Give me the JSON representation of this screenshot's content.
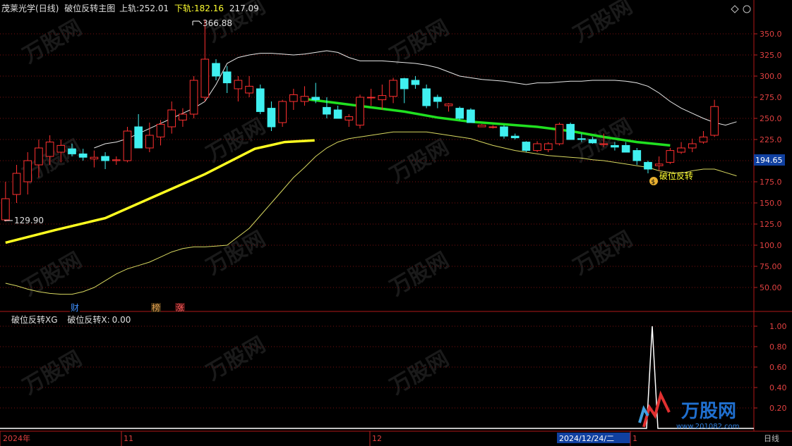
{
  "main_header": {
    "stock": "茂莱光学",
    "period": "(日线)",
    "indicator": "破位反转主图",
    "upper_label": "上轨:",
    "upper_value": "252.01",
    "lower_label": "下轨:",
    "lower_value": "182.16",
    "lower_value2": "217.09"
  },
  "sub_header": {
    "indicator": "破位反转XG",
    "item_label": "破位反转X:",
    "item_value": "0.00"
  },
  "annotations": {
    "high_label": "366.88",
    "low_label": "129.90",
    "signal_label": "破位反转",
    "current_price": "194.65",
    "tag_cai": "财",
    "tag_bang": "榜",
    "tag_zhang": "涨",
    "signal_coin": "$"
  },
  "x_axis": {
    "year": "2024年",
    "month_11": "11",
    "month_12": "12",
    "month_1": "1",
    "cursor_date": "2024/12/24/二",
    "period_label": "日线"
  },
  "watermark": {
    "brand": "万股网",
    "url": "www.201082.com"
  },
  "colors": {
    "up": "#ff3030",
    "down": "#40f0f0",
    "upper_band": "#e8e8e8",
    "lower_band": "#e8e850",
    "thick_yellow": "#ffff20",
    "thick_green": "#20e020",
    "axis": "#c02020"
  },
  "chart_data": [
    {
      "type": "candlestick",
      "title": "破位反转主图",
      "ylim": [
        30,
        375
      ],
      "y_ticks": [
        50,
        75,
        100,
        125,
        150,
        175,
        200,
        225,
        250,
        275,
        300,
        325,
        350
      ],
      "y_tick_labels": [
        "50.00",
        "75.00",
        "100.0",
        "125.0",
        "150.0",
        "175.0",
        "200.0",
        "225.0",
        "250.0",
        "275.0",
        "300.0",
        "325.0",
        "350.0"
      ],
      "candles": [
        {
          "o": 130,
          "h": 175,
          "l": 128,
          "c": 155
        },
        {
          "o": 160,
          "h": 195,
          "l": 150,
          "c": 185
        },
        {
          "o": 175,
          "h": 210,
          "l": 160,
          "c": 200
        },
        {
          "o": 195,
          "h": 225,
          "l": 180,
          "c": 215
        },
        {
          "o": 205,
          "h": 230,
          "l": 195,
          "c": 222
        },
        {
          "o": 210,
          "h": 225,
          "l": 198,
          "c": 218
        },
        {
          "o": 214,
          "h": 220,
          "l": 205,
          "c": 208
        },
        {
          "o": 208,
          "h": 214,
          "l": 200,
          "c": 204
        },
        {
          "o": 202,
          "h": 212,
          "l": 192,
          "c": 204
        },
        {
          "o": 205,
          "h": 210,
          "l": 190,
          "c": 200
        },
        {
          "o": 200,
          "h": 205,
          "l": 195,
          "c": 201
        },
        {
          "o": 200,
          "h": 240,
          "l": 198,
          "c": 235
        },
        {
          "o": 240,
          "h": 255,
          "l": 225,
          "c": 215
        },
        {
          "o": 215,
          "h": 245,
          "l": 210,
          "c": 230
        },
        {
          "o": 228,
          "h": 248,
          "l": 218,
          "c": 243
        },
        {
          "o": 240,
          "h": 270,
          "l": 232,
          "c": 260
        },
        {
          "o": 248,
          "h": 262,
          "l": 240,
          "c": 255
        },
        {
          "o": 255,
          "h": 300,
          "l": 250,
          "c": 295
        },
        {
          "o": 275,
          "h": 367,
          "l": 270,
          "c": 320
        },
        {
          "o": 315,
          "h": 320,
          "l": 295,
          "c": 300
        },
        {
          "o": 305,
          "h": 312,
          "l": 280,
          "c": 292
        },
        {
          "o": 285,
          "h": 300,
          "l": 270,
          "c": 295
        },
        {
          "o": 280,
          "h": 300,
          "l": 275,
          "c": 288
        },
        {
          "o": 285,
          "h": 290,
          "l": 255,
          "c": 258
        },
        {
          "o": 262,
          "h": 270,
          "l": 235,
          "c": 240
        },
        {
          "o": 245,
          "h": 272,
          "l": 240,
          "c": 270
        },
        {
          "o": 270,
          "h": 285,
          "l": 260,
          "c": 278
        },
        {
          "o": 270,
          "h": 288,
          "l": 265,
          "c": 276
        },
        {
          "o": 275,
          "h": 292,
          "l": 268,
          "c": 272
        },
        {
          "o": 263,
          "h": 275,
          "l": 250,
          "c": 255
        },
        {
          "o": 260,
          "h": 265,
          "l": 250,
          "c": 250
        },
        {
          "o": 248,
          "h": 255,
          "l": 240,
          "c": 252
        },
        {
          "o": 242,
          "h": 278,
          "l": 238,
          "c": 275
        },
        {
          "o": 275,
          "h": 285,
          "l": 265,
          "c": 275
        },
        {
          "o": 272,
          "h": 290,
          "l": 260,
          "c": 277
        },
        {
          "o": 276,
          "h": 298,
          "l": 268,
          "c": 295
        },
        {
          "o": 297,
          "h": 298,
          "l": 268,
          "c": 285
        },
        {
          "o": 295,
          "h": 300,
          "l": 285,
          "c": 290
        },
        {
          "o": 285,
          "h": 290,
          "l": 262,
          "c": 265
        },
        {
          "o": 275,
          "h": 278,
          "l": 262,
          "c": 270
        },
        {
          "o": 265,
          "h": 268,
          "l": 258,
          "c": 267
        },
        {
          "o": 262,
          "h": 264,
          "l": 248,
          "c": 250
        },
        {
          "o": 260,
          "h": 262,
          "l": 245,
          "c": 245
        },
        {
          "o": 240,
          "h": 243,
          "l": 240,
          "c": 242
        },
        {
          "o": 240,
          "h": 242,
          "l": 238,
          "c": 240
        },
        {
          "o": 240,
          "h": 242,
          "l": 226,
          "c": 229
        },
        {
          "o": 229,
          "h": 232,
          "l": 225,
          "c": 227
        },
        {
          "o": 222,
          "h": 223,
          "l": 210,
          "c": 212
        },
        {
          "o": 212,
          "h": 223,
          "l": 210,
          "c": 220
        },
        {
          "o": 213,
          "h": 222,
          "l": 210,
          "c": 220
        },
        {
          "o": 220,
          "h": 245,
          "l": 218,
          "c": 243
        },
        {
          "o": 243,
          "h": 245,
          "l": 225,
          "c": 225
        },
        {
          "o": 226,
          "h": 232,
          "l": 222,
          "c": 225
        },
        {
          "o": 225,
          "h": 228,
          "l": 220,
          "c": 221
        },
        {
          "o": 219,
          "h": 232,
          "l": 216,
          "c": 220
        },
        {
          "o": 218,
          "h": 222,
          "l": 212,
          "c": 216
        },
        {
          "o": 218,
          "h": 222,
          "l": 210,
          "c": 210
        },
        {
          "o": 212,
          "h": 215,
          "l": 195,
          "c": 200
        },
        {
          "o": 198,
          "h": 200,
          "l": 185,
          "c": 190
        },
        {
          "o": 194,
          "h": 205,
          "l": 188,
          "c": 196
        },
        {
          "o": 198,
          "h": 215,
          "l": 196,
          "c": 212
        },
        {
          "o": 210,
          "h": 222,
          "l": 208,
          "c": 215
        },
        {
          "o": 215,
          "h": 226,
          "l": 210,
          "c": 220
        },
        {
          "o": 222,
          "h": 235,
          "l": 220,
          "c": 228
        },
        {
          "o": 230,
          "h": 272,
          "l": 228,
          "c": 264
        }
      ],
      "upper_band": [
        null,
        null,
        null,
        null,
        null,
        null,
        null,
        null,
        215,
        220,
        222,
        226,
        232,
        238,
        244,
        250,
        256,
        262,
        270,
        290,
        315,
        322,
        325,
        327,
        327,
        326,
        325,
        326,
        328,
        330,
        328,
        322,
        318,
        318,
        318,
        317,
        316,
        315,
        313,
        310,
        305,
        300,
        298,
        296,
        295,
        294,
        292,
        290,
        292,
        292,
        293,
        294,
        294,
        295,
        295,
        295,
        294,
        292,
        288,
        280,
        270,
        262,
        256,
        250,
        245,
        242,
        246
      ],
      "lower_band": [
        55,
        52,
        48,
        45,
        43,
        42,
        42,
        45,
        50,
        58,
        66,
        72,
        76,
        80,
        86,
        92,
        96,
        98,
        98,
        99,
        100,
        110,
        120,
        135,
        150,
        165,
        180,
        192,
        205,
        215,
        222,
        226,
        228,
        230,
        232,
        234,
        234,
        234,
        234,
        232,
        230,
        228,
        226,
        222,
        218,
        215,
        212,
        210,
        208,
        206,
        205,
        204,
        203,
        201,
        200,
        198,
        196,
        194,
        192,
        188,
        186,
        185,
        188,
        190,
        190,
        186,
        182
      ],
      "thick_yellow": [
        [
          0,
          103
        ],
        [
          5,
          118
        ],
        [
          10,
          132
        ],
        [
          15,
          158
        ],
        [
          20,
          184
        ],
        [
          25,
          214
        ],
        [
          28,
          222
        ],
        [
          31,
          224
        ]
      ],
      "green_line": [
        [
          45,
          273
        ],
        [
          50,
          268
        ],
        [
          55,
          263
        ],
        [
          60,
          258
        ],
        [
          65,
          251
        ],
        [
          70,
          246
        ],
        [
          75,
          243
        ],
        [
          80,
          240
        ],
        [
          85,
          235
        ],
        [
          90,
          228
        ],
        [
          95,
          222
        ],
        [
          100,
          218
        ]
      ]
    },
    {
      "type": "line",
      "title": "破位反转XG",
      "series": [
        {
          "name": "破位反转X",
          "values": "0 everywhere except spike to 1.00 at signal bar"
        }
      ],
      "ylim": [
        0,
        1.1
      ],
      "y_ticks": [
        0.2,
        0.4,
        0.6,
        0.8,
        1.0
      ],
      "y_tick_labels": [
        "0.20",
        "0.40",
        "0.60",
        "0.80",
        "1.00"
      ],
      "spike_value": 1.0
    }
  ]
}
